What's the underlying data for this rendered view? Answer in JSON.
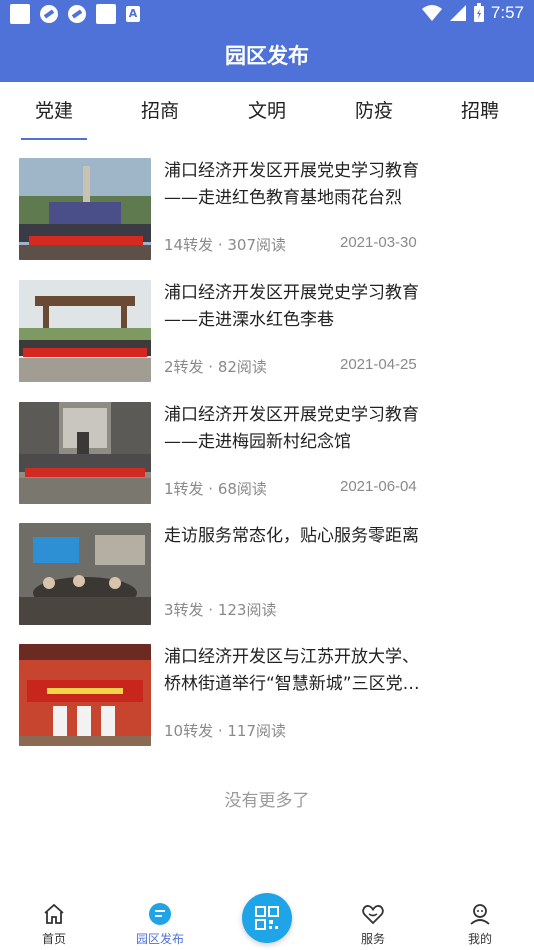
{
  "statusbar": {
    "time": "7:57"
  },
  "header": {
    "title": "园区发布"
  },
  "tabs": [
    {
      "label": "党建",
      "active": true
    },
    {
      "label": "招商"
    },
    {
      "label": "文明"
    },
    {
      "label": "防疫"
    },
    {
      "label": "招聘"
    }
  ],
  "news": [
    {
      "title": "浦口经济开发区开展党史学习教育——走进红色教育基地雨花台烈士…",
      "meta": "14转发 · 307阅读",
      "date": "2021-03-30"
    },
    {
      "title": "浦口经济开发区开展党史学习教育——走进溧水红色李巷",
      "meta": "2转发 · 82阅读",
      "date": "2021-04-25"
    },
    {
      "title": "浦口经济开发区开展党史学习教育——走进梅园新村纪念馆",
      "meta": "1转发 · 68阅读",
      "date": "2021-06-04"
    },
    {
      "title": "走访服务常态化，贴心服务零距离",
      "meta": "3转发 · 123阅读",
      "date": ""
    },
    {
      "title": "浦口经济开发区与江苏开放大学、桥林街道举行“智慧新城”三区党…",
      "meta": "10转发 · 117阅读",
      "date": ""
    }
  ],
  "list_footer": "没有更多了",
  "bottom_nav": [
    {
      "label": "首页",
      "icon": "home-icon"
    },
    {
      "label": "园区发布",
      "icon": "chat-icon",
      "active": true
    },
    {
      "label": "",
      "icon": "qr-scan-icon"
    },
    {
      "label": "服务",
      "icon": "heart-icon"
    },
    {
      "label": "我的",
      "icon": "user-icon"
    }
  ],
  "colors": {
    "primary": "#4f72d9",
    "scan": "#1fa4e7"
  }
}
